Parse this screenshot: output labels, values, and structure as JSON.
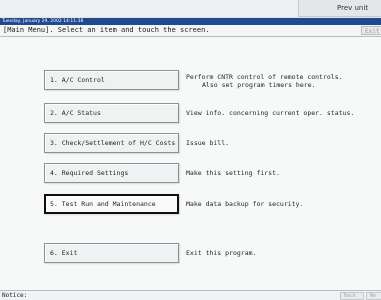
{
  "corner": {
    "label": "Prev unit"
  },
  "titlebar": {
    "datetime": "Tuesday, January 29, 2002 14:11:38"
  },
  "header": {
    "instruction": "[Main Menu]. Select an item and touch the screen.",
    "exit_label": "Exit"
  },
  "menu": [
    {
      "label": "1. A/C Control",
      "desc_lines": [
        "Perform CNTR control of remote controls.",
        "Also set program timers here."
      ]
    },
    {
      "label": "2. A/C Status",
      "desc_lines": [
        "View info. concerning current oper. status."
      ]
    },
    {
      "label": "3. Check/Settlement of H/C Costs",
      "desc_lines": [
        "Issue bill."
      ]
    },
    {
      "label": "4. Required Settings",
      "desc_lines": [
        "Make this setting first."
      ]
    },
    {
      "label": "5. Test Run and Maintenance",
      "desc_lines": [
        "Make data backup for security."
      ]
    },
    {
      "label": "6. Exit",
      "desc_lines": [
        "Exit this program."
      ]
    }
  ],
  "footer": {
    "notice_label": "Notice:",
    "back_label": "Back",
    "next_label": "Ne"
  },
  "colors": {
    "titlebar": "#1f4a8f",
    "selected_border": "#0f0f0f"
  }
}
